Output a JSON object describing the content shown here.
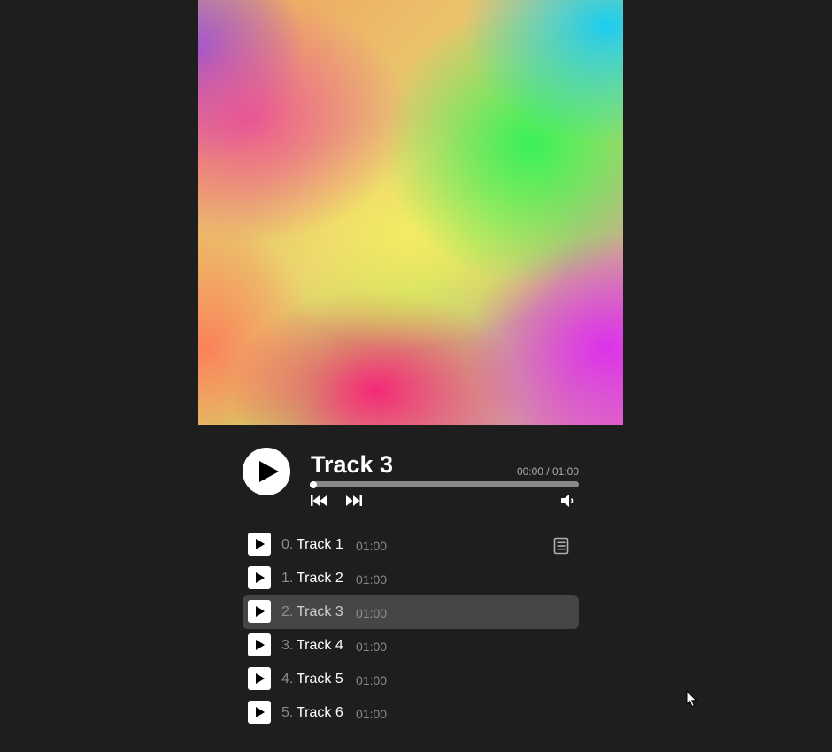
{
  "player": {
    "title": "Track 3",
    "time": "00:00 / 01:00",
    "progress_fraction": 0.0
  },
  "playlist": {
    "tracks": [
      {
        "index": "0.",
        "title": "Track 1",
        "duration": "01:00",
        "active": false
      },
      {
        "index": "1.",
        "title": "Track 2",
        "duration": "01:00",
        "active": false
      },
      {
        "index": "2.",
        "title": "Track 3",
        "duration": "01:00",
        "active": true
      },
      {
        "index": "3.",
        "title": "Track 4",
        "duration": "01:00",
        "active": false
      },
      {
        "index": "4.",
        "title": "Track 5",
        "duration": "01:00",
        "active": false
      },
      {
        "index": "5.",
        "title": "Track 6",
        "duration": "01:00",
        "active": false
      }
    ]
  },
  "icons": {
    "big_play": "play-icon",
    "previous": "skip-previous-icon",
    "next": "skip-next-icon",
    "volume": "volume-icon",
    "lyrics": "lyrics-document-icon",
    "row_play": "play-icon",
    "cursor": "mouse-pointer-icon"
  },
  "colors": {
    "background": "#1e1e1e",
    "active_row": "#464646",
    "progress_track": "#8a8a8a",
    "muted_text": "#8a8a8a"
  }
}
